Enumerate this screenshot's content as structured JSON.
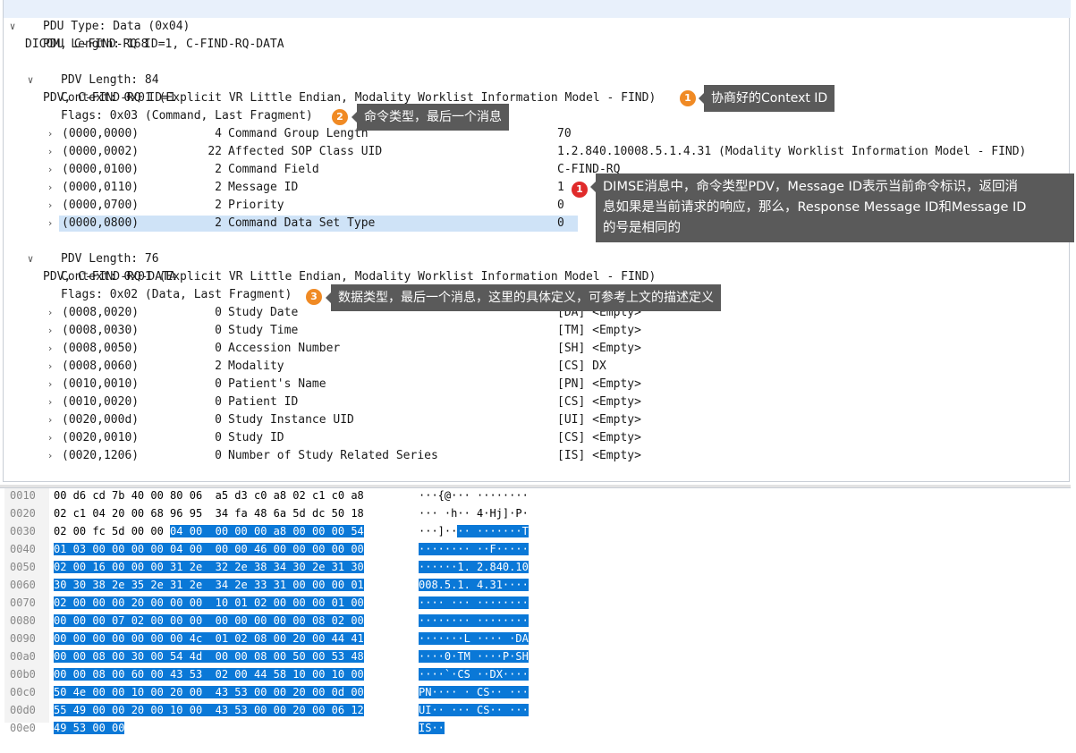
{
  "tree": {
    "root_label": "DICOM, C-FIND-RQ ID=1, C-FIND-RQ-DATA",
    "pdu_type": "PDU Type: Data (0x04)",
    "pdu_length": "PDU Length: 168",
    "pdv1": {
      "label": "PDV, C-FIND-RQ ID=1",
      "length": "PDV Length: 84",
      "context": "Context: 0x01 (Explicit VR Little Endian, Modality Worklist Information Model - FIND)",
      "flags": "Flags: 0x03 (Command, Last Fragment)",
      "elements": [
        {
          "tag": "(0000,0000)",
          "len": "4",
          "name": "Command Group Length",
          "value": "70"
        },
        {
          "tag": "(0000,0002)",
          "len": "22",
          "name": "Affected SOP Class UID",
          "value": "1.2.840.10008.5.1.4.31 (Modality Worklist Information Model - FIND)"
        },
        {
          "tag": "(0000,0100)",
          "len": "2",
          "name": "Command Field",
          "value": "C-FIND-RQ"
        },
        {
          "tag": "(0000,0110)",
          "len": "2",
          "name": "Message ID",
          "value": "1"
        },
        {
          "tag": "(0000,0700)",
          "len": "2",
          "name": "Priority",
          "value": "0"
        },
        {
          "tag": "(0000,0800)",
          "len": "2",
          "name": "Command Data Set Type",
          "value": "0"
        }
      ]
    },
    "pdv2": {
      "label": "PDV, C-FIND-RQ-DATA",
      "length": "PDV Length: 76",
      "context": "Context: 0x01 (Explicit VR Little Endian, Modality Worklist Information Model - FIND)",
      "flags": "Flags: 0x02 (Data, Last Fragment)",
      "elements": [
        {
          "tag": "(0008,0020)",
          "len": "0",
          "name": "Study Date",
          "value": "[DA] <Empty>"
        },
        {
          "tag": "(0008,0030)",
          "len": "0",
          "name": "Study Time",
          "value": "[TM] <Empty>"
        },
        {
          "tag": "(0008,0050)",
          "len": "0",
          "name": "Accession Number",
          "value": "[SH] <Empty>"
        },
        {
          "tag": "(0008,0060)",
          "len": "2",
          "name": "Modality",
          "value": "[CS] DX"
        },
        {
          "tag": "(0010,0010)",
          "len": "0",
          "name": "Patient's Name",
          "value": "[PN] <Empty>"
        },
        {
          "tag": "(0010,0020)",
          "len": "0",
          "name": "Patient ID",
          "value": "[CS] <Empty>"
        },
        {
          "tag": "(0020,000d)",
          "len": "0",
          "name": "Study Instance UID",
          "value": "[UI] <Empty>"
        },
        {
          "tag": "(0020,0010)",
          "len": "0",
          "name": "Study ID",
          "value": "[CS] <Empty>"
        },
        {
          "tag": "(0020,1206)",
          "len": "0",
          "name": "Number of Study Related Series",
          "value": "[IS] <Empty>"
        }
      ]
    }
  },
  "callouts": {
    "c1": {
      "num": "1",
      "text": "协商好的Context ID",
      "color": "#f08a24"
    },
    "c2": {
      "num": "2",
      "text": "命令类型，最后一个消息",
      "color": "#f08a24"
    },
    "c3": {
      "num": "3",
      "text": "数据类型，最后一个消息，这里的具体定义，可参考上文的描述定义",
      "color": "#f08a24"
    },
    "c4": {
      "num": "1",
      "line1": "DIMSE消息中，命令类型PDV，Message ID表示当前命令标识，返回消",
      "line2": "息如果是当前请求的响应，那么，Response Message ID和Message ID",
      "line3": "的号是相同的",
      "color": "#e02b2b"
    }
  },
  "hex": [
    {
      "off": "0010",
      "p": "00 d6 cd 7b 40 00 80 06  a5 d3 c0 a8 02 c1 c0 a8",
      "h": "",
      "a": "···{@··· ········",
      "ah": ""
    },
    {
      "off": "0020",
      "p": "02 c1 04 20 00 68 96 95  34 fa 48 6a 5d dc 50 18",
      "h": "",
      "a": "··· ·h·· 4·Hj]·P·",
      "ah": ""
    },
    {
      "off": "0030",
      "p": "02 00 fc 5d 00 00 ",
      "h": "04 00  00 00 00 a8 00 00 00 54",
      "a": "···]··",
      "ah": "·· ·······T"
    },
    {
      "off": "0040",
      "p": "",
      "h": "01 03 00 00 00 00 04 00  00 00 46 00 00 00 00 00",
      "a": "",
      "ah": "········ ··F·····"
    },
    {
      "off": "0050",
      "p": "",
      "h": "02 00 16 00 00 00 31 2e  32 2e 38 34 30 2e 31 30",
      "a": "",
      "ah": "······1. 2.840.10"
    },
    {
      "off": "0060",
      "p": "",
      "h": "30 30 38 2e 35 2e 31 2e  34 2e 33 31 00 00 00 01",
      "a": "",
      "ah": "008.5.1. 4.31····"
    },
    {
      "off": "0070",
      "p": "",
      "h": "02 00 00 00 20 00 00 00  10 01 02 00 00 00 01 00",
      "a": "",
      "ah": "···· ··· ········"
    },
    {
      "off": "0080",
      "p": "",
      "h": "00 00 00 07 02 00 00 00  00 00 00 00 00 08 02 00",
      "a": "",
      "ah": "········ ········"
    },
    {
      "off": "0090",
      "p": "",
      "h": "00 00 00 00 00 00 00 4c  01 02 08 00 20 00 44 41",
      "a": "",
      "ah": "·······L ···· ·DA"
    },
    {
      "off": "00a0",
      "p": "",
      "h": "00 00 08 00 30 00 54 4d  00 00 08 00 50 00 53 48",
      "a": "",
      "ah": "····0·TM ····P·SH"
    },
    {
      "off": "00b0",
      "p": "",
      "h": "00 00 08 00 60 00 43 53  02 00 44 58 10 00 10 00",
      "a": "",
      "ah": "····`·CS ··DX····"
    },
    {
      "off": "00c0",
      "p": "",
      "h": "50 4e 00 00 10 00 20 00  43 53 00 00 20 00 0d 00",
      "a": "",
      "ah": "PN···· · CS·· ···"
    },
    {
      "off": "00d0",
      "p": "",
      "h": "55 49 00 00 20 00 10 00  43 53 00 00 20 00 06 12",
      "a": "",
      "ah": "UI·· ··· CS·· ···"
    },
    {
      "off": "00e0",
      "p": "",
      "h": "49 53 00 00",
      "a": "",
      "ah": "IS··"
    }
  ]
}
